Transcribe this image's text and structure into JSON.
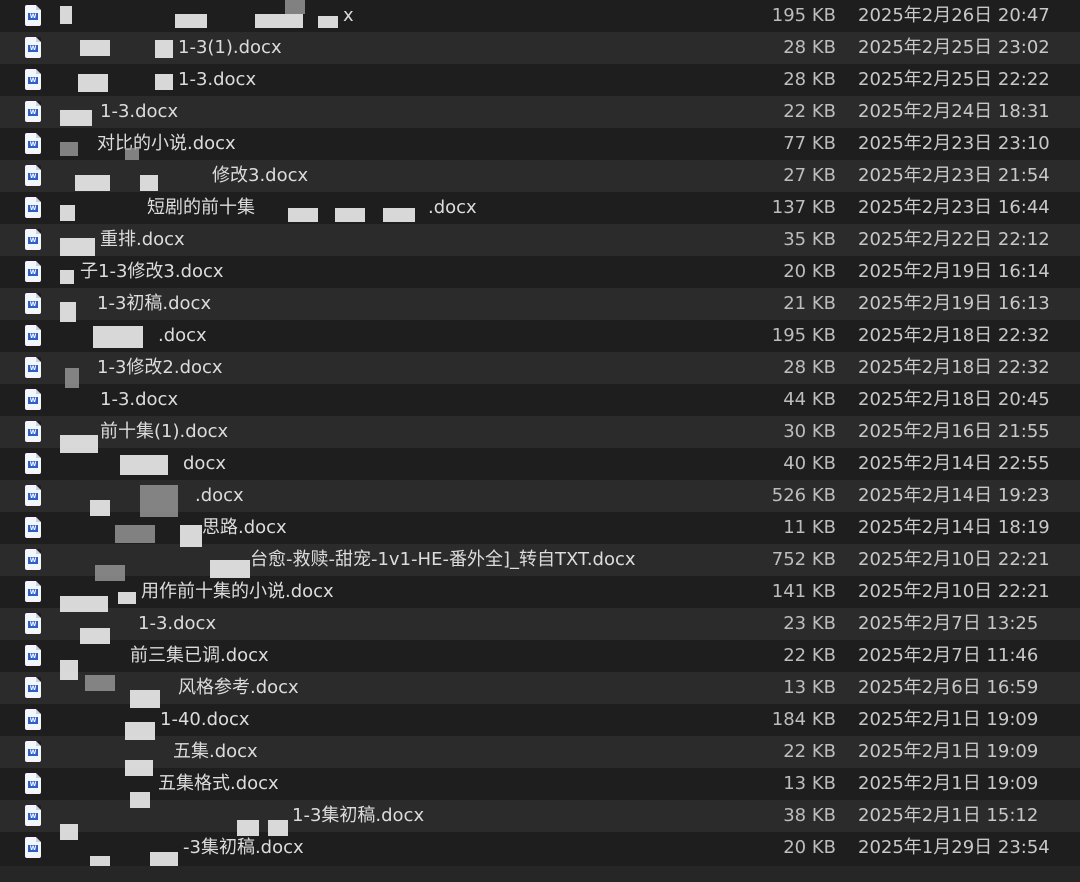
{
  "files": [
    {
      "name": "x",
      "size": "195 KB",
      "modified": "2025年2月26日 20:47"
    },
    {
      "name": "1-3(1).docx",
      "size": "28 KB",
      "modified": "2025年2月25日 23:02"
    },
    {
      "name": "1-3.docx",
      "size": "28 KB",
      "modified": "2025年2月25日 22:22"
    },
    {
      "name": "1-3.docx",
      "size": "22 KB",
      "modified": "2025年2月24日 18:31"
    },
    {
      "name": "对比的小说.docx",
      "size": "77 KB",
      "modified": "2025年2月23日 23:10"
    },
    {
      "name": "修改3.docx",
      "size": "27 KB",
      "modified": "2025年2月23日 21:54"
    },
    {
      "name": "短剧的前十集",
      "name_suffix": ".docx",
      "size": "137 KB",
      "modified": "2025年2月23日 16:44"
    },
    {
      "name": "重排.docx",
      "size": "35 KB",
      "modified": "2025年2月22日 22:12"
    },
    {
      "name": "子1-3修改3.docx",
      "size": "20 KB",
      "modified": "2025年2月19日 16:14"
    },
    {
      "name": "1-3初稿.docx",
      "size": "21 KB",
      "modified": "2025年2月19日 16:13"
    },
    {
      "name": ".docx",
      "size": "195 KB",
      "modified": "2025年2月18日 22:32"
    },
    {
      "name": "1-3修改2.docx",
      "size": "28 KB",
      "modified": "2025年2月18日 22:32"
    },
    {
      "name": "1-3.docx",
      "size": "44 KB",
      "modified": "2025年2月18日 20:45"
    },
    {
      "name": "前十集(1).docx",
      "size": "30 KB",
      "modified": "2025年2月16日 21:55"
    },
    {
      "name": "docx",
      "size": "40 KB",
      "modified": "2025年2月14日 22:55"
    },
    {
      "name": ".docx",
      "size": "526 KB",
      "modified": "2025年2月14日 19:23"
    },
    {
      "name": "思路.docx",
      "size": "11 KB",
      "modified": "2025年2月14日 18:19"
    },
    {
      "name": "台愈-救赎-甜宠-1v1-HE-番外全]_转自TXT.docx",
      "size": "752 KB",
      "modified": "2025年2月10日 22:21"
    },
    {
      "name": "用作前十集的小说.docx",
      "size": "141 KB",
      "modified": "2025年2月10日 22:21"
    },
    {
      "name": "1-3.docx",
      "size": "23 KB",
      "modified": "2025年2月7日 13:25"
    },
    {
      "name": "前三集已调.docx",
      "size": "22 KB",
      "modified": "2025年2月7日 11:46"
    },
    {
      "name": "风格参考.docx",
      "size": "13 KB",
      "modified": "2025年2月6日 16:59"
    },
    {
      "name": "1-40.docx",
      "size": "184 KB",
      "modified": "2025年2月1日 19:09"
    },
    {
      "name": "五集.docx",
      "size": "22 KB",
      "modified": "2025年2月1日 19:09"
    },
    {
      "name": "五集格式.docx",
      "size": "13 KB",
      "modified": "2025年2月1日 19:09"
    },
    {
      "name": "1-3集初稿.docx",
      "size": "38 KB",
      "modified": "2025年2月1日 15:12"
    },
    {
      "name": "-3集初稿.docx",
      "size": "20 KB",
      "modified": "2025年1月29日 23:54"
    }
  ],
  "icon": {
    "name": "word-document-icon",
    "glyph": "W",
    "color": "#2b5fc9"
  }
}
